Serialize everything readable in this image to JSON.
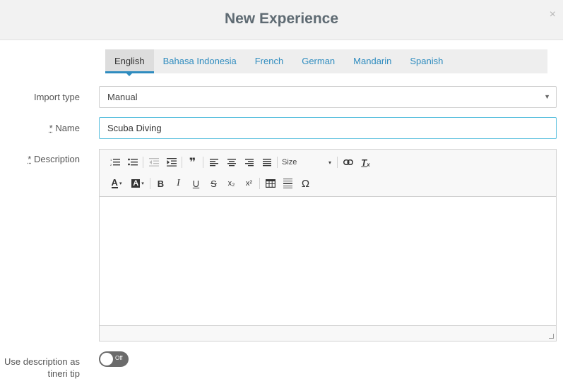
{
  "dialog": {
    "title": "New Experience",
    "close": "×"
  },
  "tabs": [
    {
      "label": "English",
      "active": true
    },
    {
      "label": "Bahasa Indonesia"
    },
    {
      "label": "French"
    },
    {
      "label": "German"
    },
    {
      "label": "Mandarin"
    },
    {
      "label": "Spanish"
    }
  ],
  "form": {
    "import_type": {
      "label": "Import type",
      "value": "Manual"
    },
    "name": {
      "required_mark": "*",
      "label": " Name",
      "value": "Scuba Diving"
    },
    "description": {
      "required_mark": "*",
      "label": " Description"
    },
    "tip": {
      "label_line1": "Use description as",
      "label_line2": "tineri tip",
      "toggle_text": "Off",
      "toggle_on": false
    }
  },
  "toolbar": {
    "size_label": "Size",
    "icons_row1": [
      "numbered-list-icon",
      "bulleted-list-icon",
      "outdent-icon",
      "indent-icon",
      "blockquote-icon",
      "align-left-icon",
      "align-center-icon",
      "align-right-icon",
      "justify-icon",
      "size-select",
      "link-icon",
      "remove-format-icon"
    ],
    "icons_row2": [
      "text-color-icon",
      "background-color-icon",
      "bold-icon",
      "italic-icon",
      "underline-icon",
      "strikethrough-icon",
      "subscript-icon",
      "superscript-icon",
      "table-icon",
      "horizontal-line-icon",
      "special-char-icon"
    ],
    "glyphs": {
      "blockquote": "❞",
      "bold": "B",
      "italic": "I",
      "underline": "U",
      "strike": "S",
      "subscript": "x₂",
      "superscript": "x²",
      "omega": "Ω",
      "text_color": "A",
      "bg_color": "A",
      "remove_format": "T"
    }
  },
  "colors": {
    "accent": "#2f8cbf",
    "focus_border": "#5bc0de",
    "toggle_off": "#6b6b6b"
  }
}
